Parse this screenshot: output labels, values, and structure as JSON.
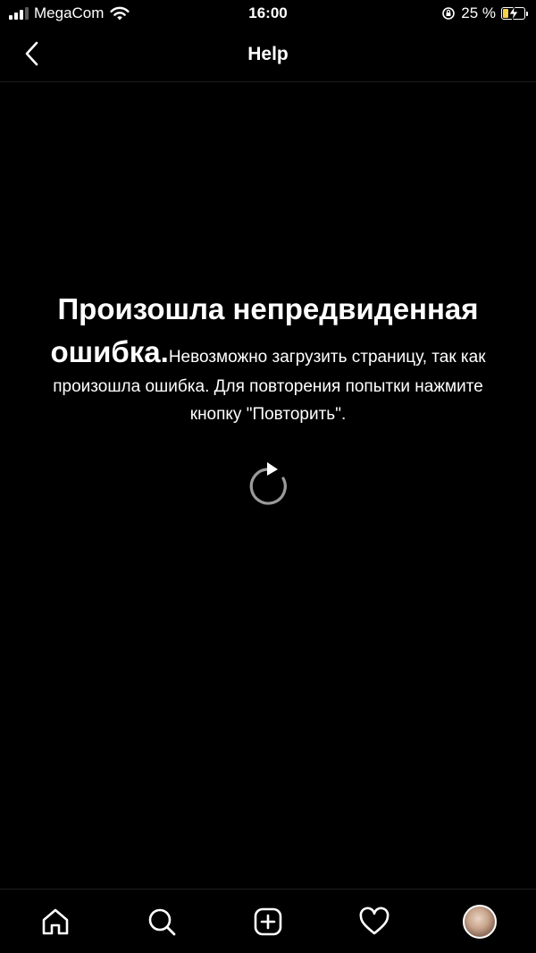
{
  "status_bar": {
    "carrier": "MegaCom",
    "time": "16:00",
    "battery_percent": "25 %",
    "battery_level": 0.25,
    "battery_color": "#f3d14a"
  },
  "header": {
    "title": "Help",
    "back_icon": "chevron-left-icon"
  },
  "error": {
    "title": "Произошла непредвиденная ошибка.",
    "message": "Невозможно загрузить страницу, так как произошла ошибка. Для повторения попытки нажмите кнопку \"Повторить\".",
    "retry_icon": "retry-icon"
  },
  "tab_bar": {
    "items": [
      {
        "icon": "home-icon"
      },
      {
        "icon": "search-icon"
      },
      {
        "icon": "add-post-icon"
      },
      {
        "icon": "heart-icon"
      },
      {
        "icon": "profile-avatar"
      }
    ]
  },
  "colors": {
    "background": "#000000",
    "text": "#ffffff",
    "retry_icon": "#9a9a9a"
  }
}
